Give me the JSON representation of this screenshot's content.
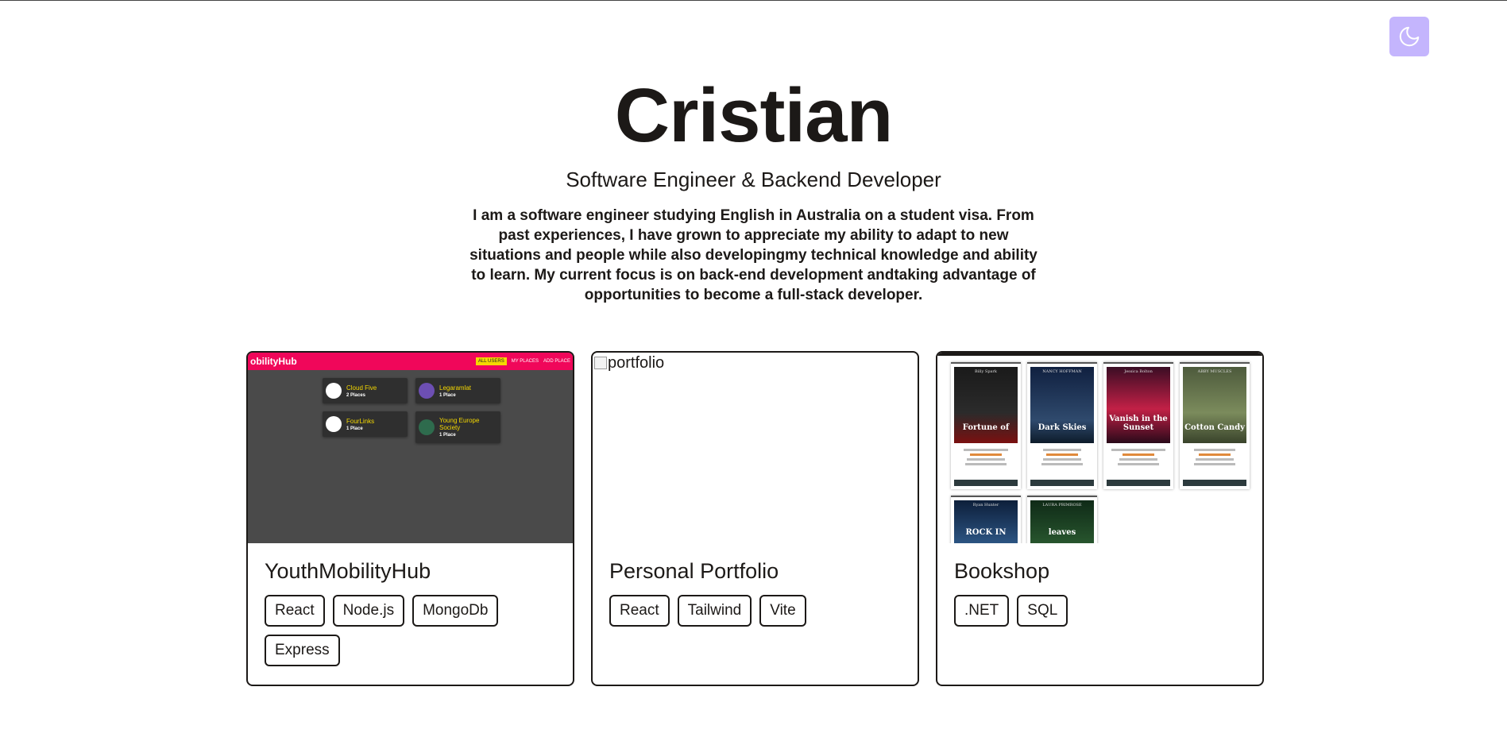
{
  "theme_toggle": {
    "icon": "moon-icon",
    "color": "#c4b5fd"
  },
  "hero": {
    "name": "Cristian",
    "subtitle": "Software Engineer & Backend Developer",
    "bio": "I am a software engineer studying English in Australia on a student visa. From past experiences, I have grown to appreciate my ability to adapt to new situations and people while also developingmy technical knowledge and ability to learn. My current focus is on back-end development andtaking advantage of opportunities to become a full-stack developer."
  },
  "projects": [
    {
      "title": "YouthMobilityHub",
      "tags": [
        "React",
        "Node.js",
        "MongoDb",
        "Express"
      ],
      "preview": {
        "logo": "obilityHub",
        "nav": [
          "ALL USERS",
          "MY PLACES",
          "ADD PLACE"
        ],
        "items": [
          {
            "name": "Cloud Five",
            "count": "2 Places"
          },
          {
            "name": "Legaramlat",
            "count": "1 Place"
          },
          {
            "name": "FourLinks",
            "count": "1 Place"
          },
          {
            "name": "Young Europe Society",
            "count": "1 Place"
          }
        ],
        "accent": "#f0075a"
      }
    },
    {
      "title": "Personal Portfolio",
      "tags": [
        "React",
        "Tailwind",
        "Vite"
      ],
      "preview": {
        "alt": "portfolio"
      }
    },
    {
      "title": "Bookshop",
      "tags": [
        ".NET",
        "SQL"
      ],
      "preview": {
        "books": [
          {
            "title": "Fortune of",
            "author": "Billy Spark"
          },
          {
            "title": "Dark Skies",
            "author": "NANCY HOFFMAN"
          },
          {
            "title": "Vanish in the Sunset",
            "author": "Jessica Bolton"
          },
          {
            "title": "Cotton Candy",
            "author": "ABBY MUSCLES"
          },
          {
            "title": "ROCK IN",
            "author": "Ryan Hunter"
          },
          {
            "title": "leaves",
            "author": "LAURA PRIMROSE"
          }
        ]
      }
    }
  ]
}
